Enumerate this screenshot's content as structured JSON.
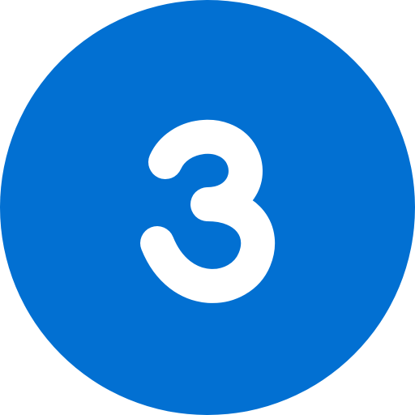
{
  "badge": {
    "number": "3",
    "background_color": "#0270D2",
    "number_color": "#FFFFFF",
    "icon": "number-three-circle-icon"
  }
}
